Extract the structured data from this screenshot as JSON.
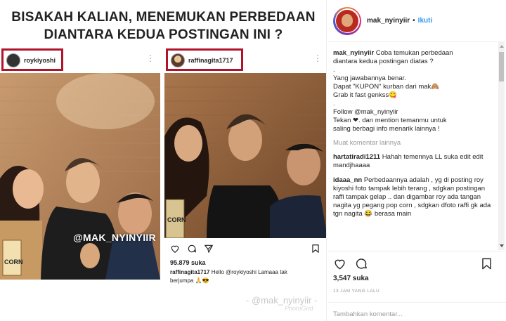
{
  "headline": {
    "line1": "BISAKAH KALIAN, MENEMUKAN PERBEDAAN",
    "line2": "DIANTARA KEDUA POSTINGAN INI ?"
  },
  "left_shot": {
    "username": "roykiyoshi",
    "photo_labels": {
      "corn": "CORN"
    },
    "watermark": "@MAK_NYINYIIR"
  },
  "right_shot": {
    "username": "raffinagita1717",
    "likes": "95.879 suka",
    "caption_user": "raffinagita1717",
    "caption_text": "Hello @roykiyoshi Lamaaa tak berjumpa 🙏😎",
    "photo_labels": {
      "corn": "CORN"
    }
  },
  "bottom_watermark": {
    "main": "- @mak_nyinyiir -",
    "sub": "PhotoGrid"
  },
  "sidebar": {
    "username": "mak_nyinyiir",
    "dot": "•",
    "follow_label": "Ikuti",
    "caption": {
      "user": "mak_nyinyiir",
      "lines": [
        "Coba temukan perbedaan",
        "diantara kedua postingan diatas ?",
        ".",
        "Yang jawabannya benar.",
        "Dapat \"KUPON\" kurban dari mak🙈",
        "Grab it fast genkss😋",
        ".",
        "Follow @mak_nyinyiir",
        "Tekan ❤. dan mention temanmu untuk",
        "saling berbagi info menarik lainnya !"
      ]
    },
    "more_comments_label": "Muat komentar lainnya",
    "comments": [
      {
        "user": "hartatiradi1211",
        "text": "Hahah temennya LL suka edit edit mandjhaaaa"
      },
      {
        "user": "idaaa_nn",
        "text": "Perbedaannya adalah , yg di posting roy kiyoshi foto tampak lebih terang , sdgkan postingan raffi tampak gelap .. dan digambar roy ada tangan nagita yg pegang pop corn , sdgkan dfoto raffi gk ada tgn nagita 😂 berasa main"
      }
    ],
    "likes": "3,547 suka",
    "timestamp": "13 JAM YANG LALU",
    "add_comment_placeholder": "Tambahkan komentar..."
  },
  "colors": {
    "highlight_box": "#b0132a",
    "follow": "#3897f0",
    "muted": "#999999"
  },
  "icons": [
    "heart-icon",
    "comment-icon",
    "share-icon",
    "bookmark-icon",
    "more-icon"
  ]
}
